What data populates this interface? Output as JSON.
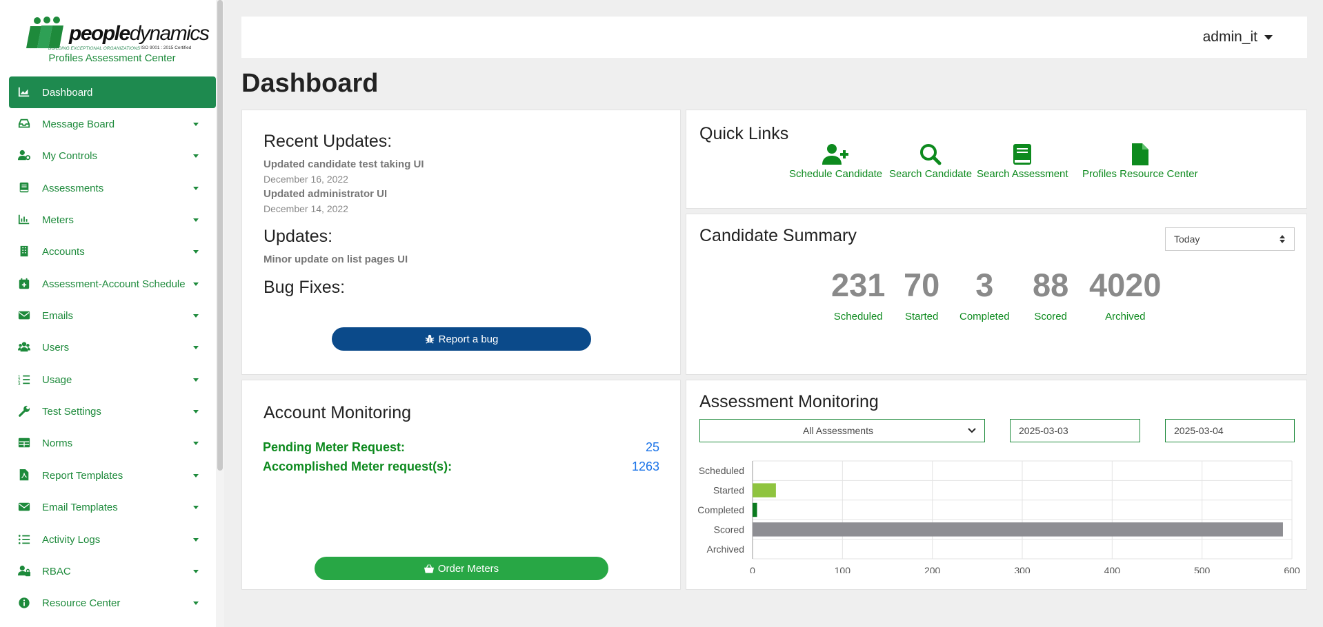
{
  "brand": {
    "name_bold": "people",
    "name_light": "dynamics",
    "tagline": "BUILDING EXCEPTIONAL ORGANIZATIONS",
    "iso": "ISO 9001 : 2015 Certified",
    "subtitle": "Profiles Assessment Center"
  },
  "sidebar": {
    "items": [
      {
        "label": "Dashboard",
        "icon": "chart-area-icon"
      },
      {
        "label": "Message Board",
        "icon": "inbox-icon"
      },
      {
        "label": "My Controls",
        "icon": "user-cog-icon"
      },
      {
        "label": "Assessments",
        "icon": "book-icon"
      },
      {
        "label": "Meters",
        "icon": "bar-chart-icon"
      },
      {
        "label": "Accounts",
        "icon": "building-icon"
      },
      {
        "label": "Assessment-Account Schedule",
        "icon": "calendar-plus-icon"
      },
      {
        "label": "Emails",
        "icon": "envelope-icon"
      },
      {
        "label": "Users",
        "icon": "users-icon"
      },
      {
        "label": "Usage",
        "icon": "list-ol-icon"
      },
      {
        "label": "Test Settings",
        "icon": "wrench-icon"
      },
      {
        "label": "Norms",
        "icon": "table-icon"
      },
      {
        "label": "Report Templates",
        "icon": "file-pdf-icon"
      },
      {
        "label": "Email Templates",
        "icon": "envelope-icon"
      },
      {
        "label": "Activity Logs",
        "icon": "list-icon"
      },
      {
        "label": "RBAC",
        "icon": "user-lock-icon"
      },
      {
        "label": "Resource Center",
        "icon": "info-circle-icon"
      }
    ]
  },
  "header": {
    "username": "admin_it"
  },
  "page": {
    "title": "Dashboard"
  },
  "updates": {
    "recent_title": "Recent Updates:",
    "entries": [
      {
        "text": "Updated candidate test taking UI",
        "date": "December 16, 2022"
      },
      {
        "text": "Updated administrator UI",
        "date": "December 14, 2022"
      }
    ],
    "updates_title": "Updates:",
    "updates_text": "Minor update on list pages UI",
    "bugfix_title": "Bug Fixes:",
    "report_bug_label": "Report a bug"
  },
  "quick_links": {
    "title": "Quick Links",
    "links": [
      {
        "label": "Schedule Candidate",
        "icon": "user-plus-icon"
      },
      {
        "label": "Search Candidate",
        "icon": "search-icon"
      },
      {
        "label": "Search Assessment",
        "icon": "book-icon"
      },
      {
        "label": "Profiles Resource Center",
        "icon": "file-icon"
      }
    ]
  },
  "candidate_summary": {
    "title": "Candidate Summary",
    "period": "Today",
    "stats": [
      {
        "value": "231",
        "label": "Scheduled"
      },
      {
        "value": "70",
        "label": "Started"
      },
      {
        "value": "3",
        "label": "Completed"
      },
      {
        "value": "88",
        "label": "Scored"
      },
      {
        "value": "4020",
        "label": "Archived"
      }
    ]
  },
  "account_monitoring": {
    "title": "Account Monitoring",
    "pending_label": "Pending Meter Request:",
    "pending_value": "25",
    "accomplished_label": "Accomplished Meter request(s):",
    "accomplished_value": "1263",
    "order_label": "Order Meters"
  },
  "assessment_monitoring": {
    "title": "Assessment Monitoring",
    "filter": "All Assessments",
    "date_from": "2025-03-03",
    "date_to": "2025-03-04"
  },
  "chart_data": {
    "type": "bar",
    "orientation": "horizontal",
    "categories": [
      "Scheduled",
      "Started",
      "Completed",
      "Scored",
      "Archived"
    ],
    "values": [
      0,
      26,
      5,
      590,
      0
    ],
    "colors": [
      "#8fc43f",
      "#8fc43f",
      "#0a7a1e",
      "#8e8e93",
      "#8fc43f"
    ],
    "xticks": [
      0,
      100,
      200,
      300,
      400,
      500,
      600
    ],
    "xlim": [
      0,
      600
    ],
    "grid": true,
    "legend": "none"
  }
}
